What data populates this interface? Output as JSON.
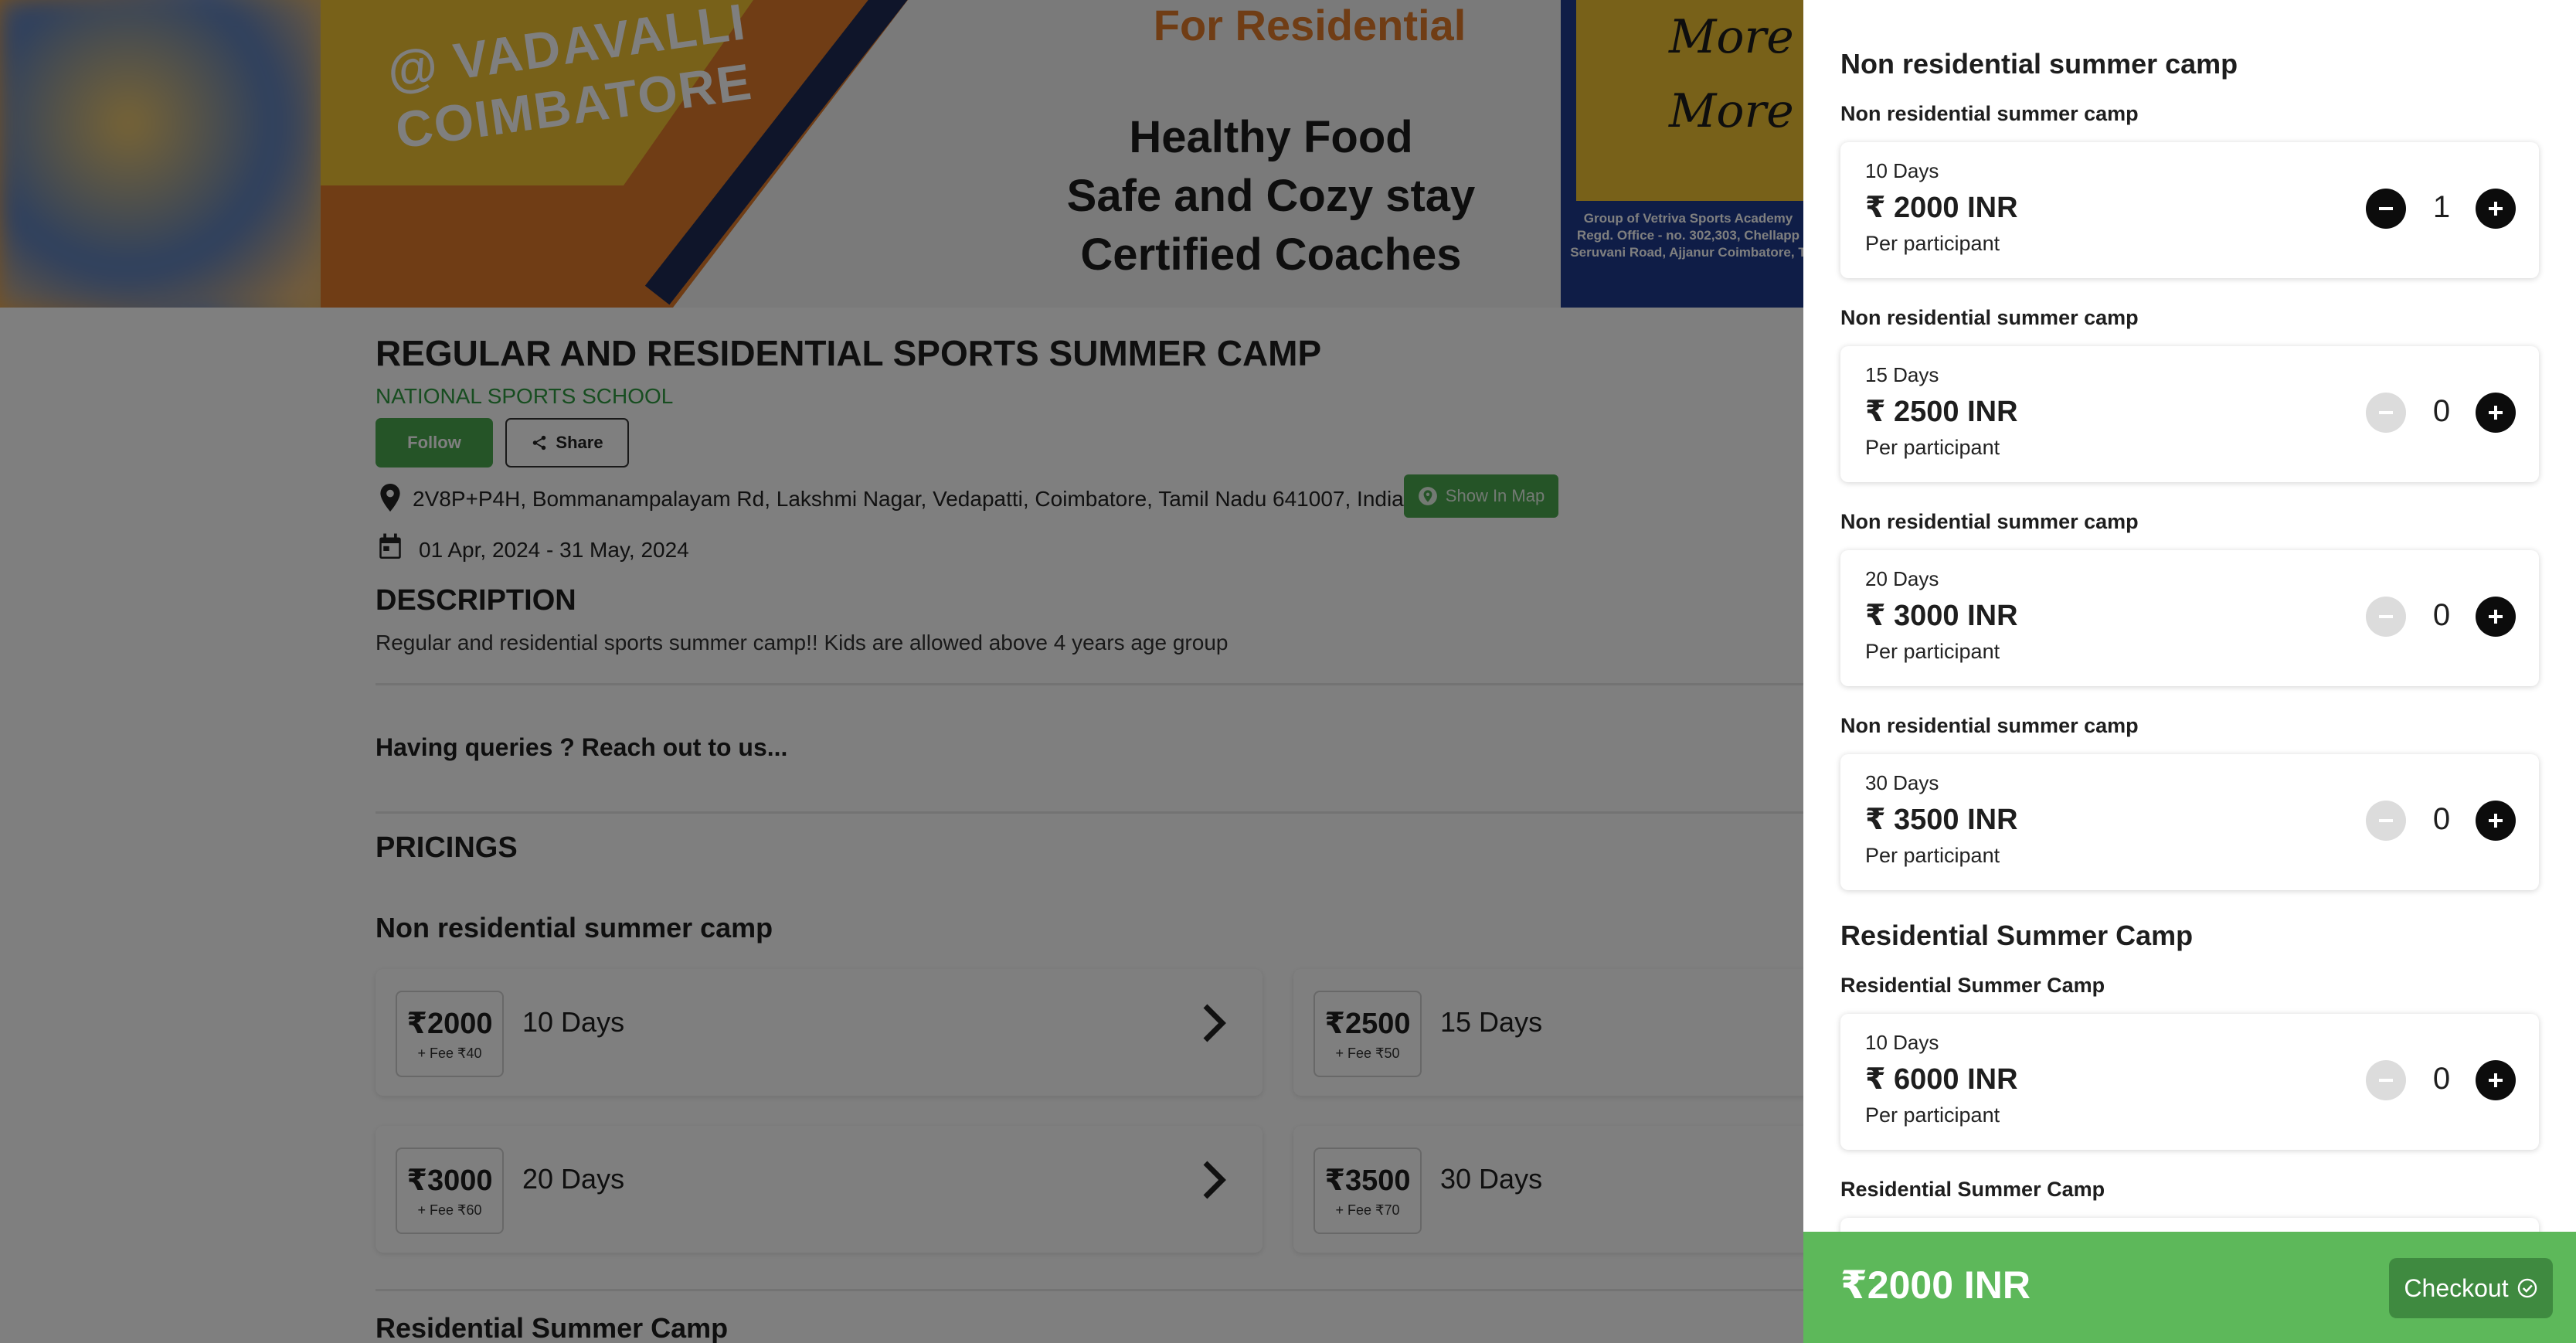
{
  "banner": {
    "poster_city_line1": "@ VADAVALLI",
    "poster_city_line2": "COIMBATORE",
    "poster_heading": "For Residential",
    "poster_line1": "Healthy Food",
    "poster_line2": "Safe and Cozy stay",
    "poster_line3": "Certified Coaches",
    "poster_right_line1": "More",
    "poster_right_line2": "More",
    "poster_right_small": "Group of Vetriva Sports Academy Regd. Office - no. 302,303, Chellapp Seruvani Road, Ajjanur Coimbatore, T"
  },
  "event": {
    "title": "REGULAR AND RESIDENTIAL SPORTS SUMMER CAMP",
    "organizer": "NATIONAL SPORTS SCHOOL",
    "follow_label": "Follow",
    "share_label": "Share",
    "address": "2V8P+P4H, Bommanampalayam Rd, Lakshmi Nagar, Vedapatti, Coimbatore, Tamil Nadu 641007, India",
    "map_label": "Show In Map",
    "dates": "01 Apr, 2024 - 31 May, 2024",
    "description_heading": "DESCRIPTION",
    "description": "Regular and residential sports summer camp!! Kids are allowed above 4 years age group",
    "queries": "Having queries ? Reach out to us...",
    "pricings_heading": "PRICINGS",
    "section1": "Non residential summer camp",
    "section2": "Residential Summer Camp"
  },
  "pricing_cards": [
    {
      "amount": "₹2000",
      "fee": "+ Fee ₹40",
      "days": "10 Days"
    },
    {
      "amount": "₹2500",
      "fee": "+ Fee ₹50",
      "days": "15 Days"
    },
    {
      "amount": "₹3000",
      "fee": "+ Fee ₹60",
      "days": "20 Days"
    },
    {
      "amount": "₹3500",
      "fee": "+ Fee ₹70",
      "days": "30 Days"
    }
  ],
  "panel": {
    "group1_title": "Non residential summer camp",
    "group2_title": "Residential Summer Camp",
    "tickets": [
      {
        "label": "Non residential summer camp",
        "days": "10 Days",
        "price": "₹ 2000 INR",
        "per": "Per participant",
        "qty": "1"
      },
      {
        "label": "Non residential summer camp",
        "days": "15 Days",
        "price": "₹ 2500 INR",
        "per": "Per participant",
        "qty": "0"
      },
      {
        "label": "Non residential summer camp",
        "days": "20 Days",
        "price": "₹ 3000 INR",
        "per": "Per participant",
        "qty": "0"
      },
      {
        "label": "Non residential summer camp",
        "days": "30 Days",
        "price": "₹ 3500 INR",
        "per": "Per participant",
        "qty": "0"
      },
      {
        "label": "Residential Summer Camp",
        "days": "10 Days",
        "price": "₹ 6000 INR",
        "per": "Per participant",
        "qty": "0"
      }
    ],
    "next_label": "Residential Summer Camp"
  },
  "checkout": {
    "total": "₹2000 INR",
    "button_label": "Checkout"
  },
  "colors": {
    "accent_green": "#4aa84f",
    "checkout_bar": "#5db85a",
    "checkout_button": "#3f8a40"
  }
}
